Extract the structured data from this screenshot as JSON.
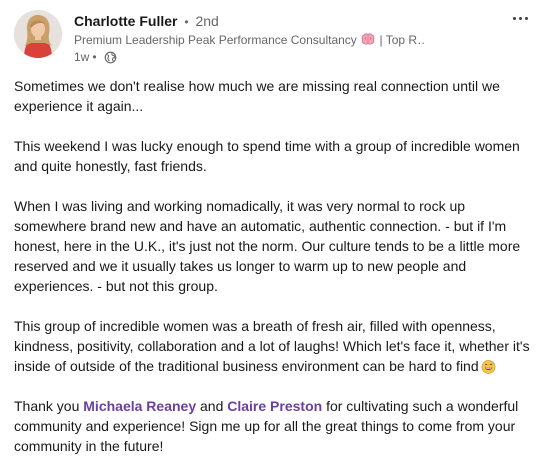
{
  "author": {
    "name": "Charlotte Fuller",
    "separator": "•",
    "degree": "2nd",
    "headline_start": "Premium Leadership Peak Performance Consultancy",
    "headline_end": "| Top R…",
    "time": "1w",
    "time_separator": "•"
  },
  "post": {
    "p1": "Sometimes we don't realise how much we are missing real connection until we experience it again...",
    "p2": "This weekend I was lucky enough to spend time with a group of incredible women and quite honestly, fast friends.",
    "p3": "When I was living and working nomadically, it was very normal to rock up somewhere brand new and have an automatic, authentic connection. - but if I'm honest, here in the U.K., it's just not the norm. Our culture tends to be a little more reserved and we it usually takes us longer to warm up to new people and experiences. - but not this group.",
    "p4": "This group of incredible women was a breath of fresh air, filled with openness, kindness, positivity, collaboration and a lot of laughs! Which let's face it, whether it's inside of outside of the traditional business environment can be hard to find",
    "p5_a": "Thank you ",
    "mention1": "Michaela Reaney",
    "p5_b": " and ",
    "mention2": "Claire Preston",
    "p5_c": " for cultivating such a wonderful community and experience! Sign me up for all the great things to come from your community in the future!"
  },
  "icons": {
    "menu": "more-horizontal-icon",
    "visibility": "globe-icon",
    "headline_emoji": "brain-emoji",
    "laugh_emoji": "grinning-sweat-emoji"
  },
  "colors": {
    "mention": "#6b3fa0",
    "secondary_text": "#666666"
  }
}
